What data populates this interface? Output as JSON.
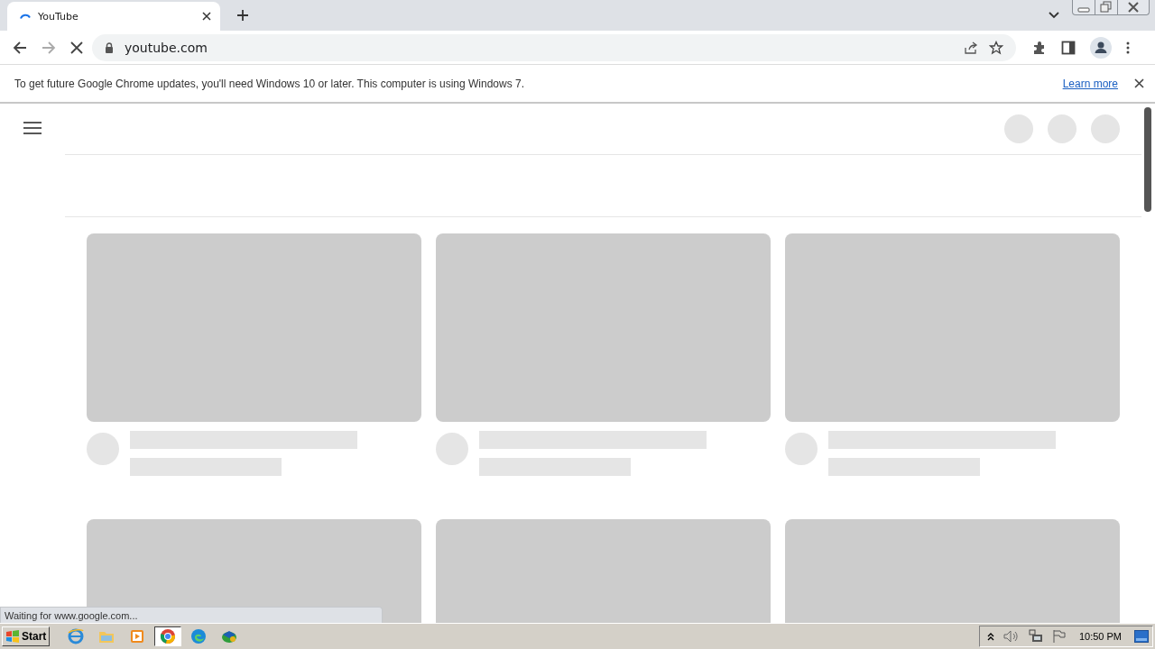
{
  "tabs": [
    {
      "title": "YouTube",
      "loading": true,
      "selected": true
    }
  ],
  "address_bar": {
    "url": "youtube.com"
  },
  "infobar": {
    "message": "To get future Google Chrome updates, you'll need Windows 10 or later. This computer is using Windows 7.",
    "link": "Learn more"
  },
  "cards": [
    {
      "kind": "placeholder"
    },
    {
      "kind": "placeholder"
    },
    {
      "kind": "placeholder"
    },
    {
      "kind": "partial"
    },
    {
      "kind": "partial"
    },
    {
      "kind": "partial"
    }
  ],
  "status_bubble": "Waiting for www.google.com...",
  "taskbar": {
    "start": "Start",
    "apps": [
      {
        "kind": "ie",
        "selected": false
      },
      {
        "kind": "folder",
        "selected": false
      },
      {
        "kind": "media",
        "selected": false
      },
      {
        "kind": "chrome",
        "selected": true
      },
      {
        "kind": "edge",
        "selected": false
      },
      {
        "kind": "network",
        "selected": false
      }
    ],
    "clock": "10:50 PM"
  }
}
